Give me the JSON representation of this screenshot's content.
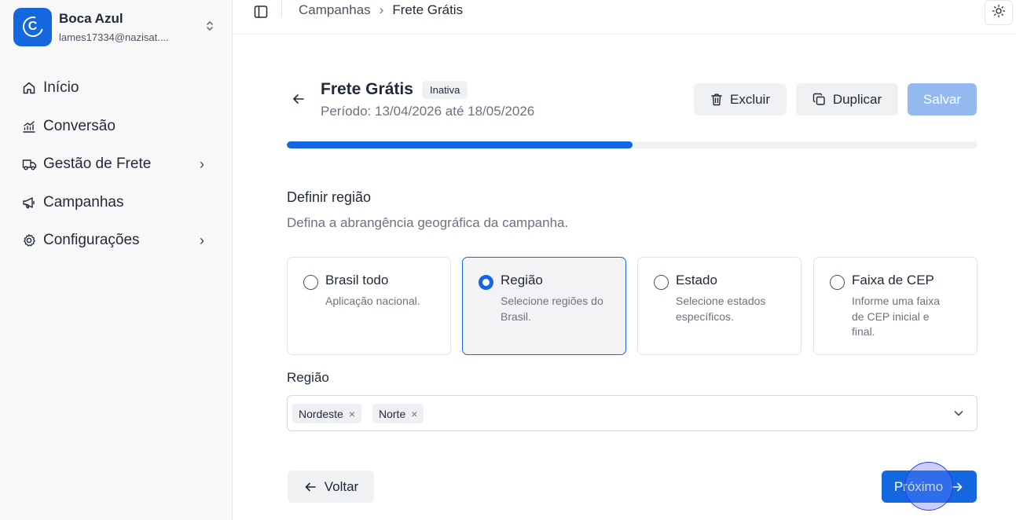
{
  "account": {
    "name": "Boca Azul",
    "email": "lames17334@nazisat....",
    "logo_letter": "C",
    "toggle_icon": "chevron-up-down-icon"
  },
  "sidebar": {
    "items": [
      {
        "label": "Início",
        "icon": "home-icon"
      },
      {
        "label": "Conversão",
        "icon": "chart-line-icon"
      },
      {
        "label": "Gestão de Frete",
        "icon": "truck-icon",
        "has_submenu": true
      },
      {
        "label": "Campanhas",
        "icon": "megaphone-icon"
      },
      {
        "label": "Configurações",
        "icon": "gear-icon",
        "has_submenu": true
      }
    ],
    "chevron": "›"
  },
  "topbar": {
    "breadcrumb": [
      "Campanhas",
      "Frete Grátis"
    ],
    "breadcrumb_sep": "›",
    "theme_icon": "sun-icon"
  },
  "header": {
    "title": "Frete Grátis",
    "status": "Inativa",
    "period": "Período: 13/04/2026 até 18/05/2026",
    "excluir_label": "Excluir",
    "duplicar_label": "Duplicar",
    "salvar_label": "Salvar"
  },
  "progress": {
    "percent": 50
  },
  "section": {
    "title": "Definir região",
    "description": "Defina a abrangência geográfica da campanha."
  },
  "options": [
    {
      "title": "Brasil todo",
      "description": "Aplicação nacional.",
      "selected": false
    },
    {
      "title": "Região",
      "description": "Selecione regiões do Brasil.",
      "selected": true
    },
    {
      "title": "Estado",
      "description": "Selecione estados específicos.",
      "selected": false
    },
    {
      "title": "Faixa de CEP",
      "description": "Informe uma faixa de CEP inicial e final.",
      "selected": false
    }
  ],
  "region_field": {
    "label": "Região",
    "chips": [
      "Nordeste",
      "Norte"
    ],
    "remove_glyph": "×"
  },
  "footer": {
    "back_label": "Voltar",
    "next_label": "Próximo"
  },
  "colors": {
    "accent": "#1567e0",
    "accent_disabled": "#93b9ee",
    "sidebar_bg": "#f8f8f9"
  }
}
